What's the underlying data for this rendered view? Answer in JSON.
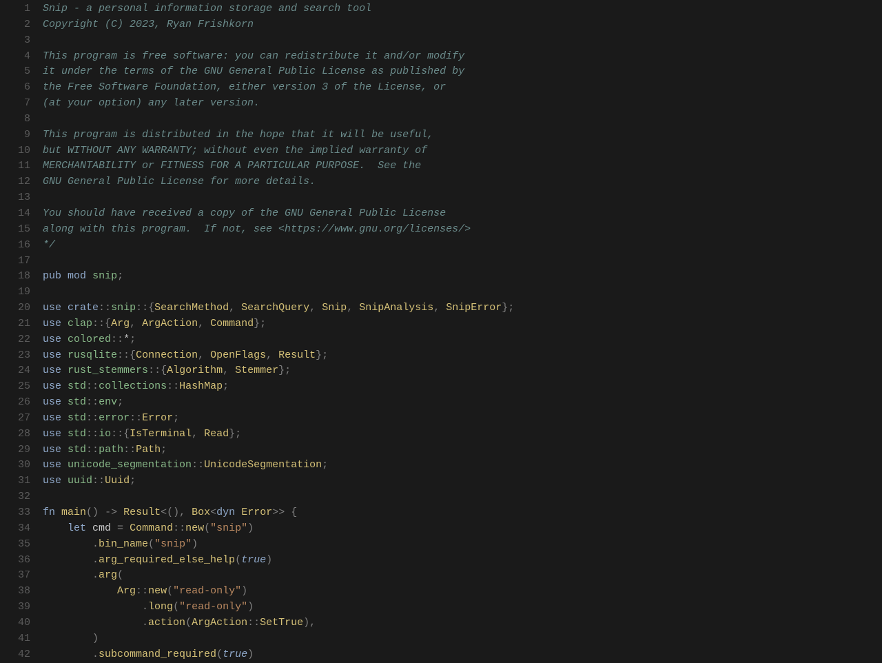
{
  "lines": [
    {
      "n": "1",
      "segs": [
        {
          "c": "comment",
          "t": "Snip - a personal information storage and search tool"
        }
      ]
    },
    {
      "n": "2",
      "segs": [
        {
          "c": "comment",
          "t": "Copyright (C) 2023, Ryan Frishkorn"
        }
      ]
    },
    {
      "n": "3",
      "segs": []
    },
    {
      "n": "4",
      "segs": [
        {
          "c": "comment",
          "t": "This program is free software: you can redistribute it and/or modify"
        }
      ]
    },
    {
      "n": "5",
      "segs": [
        {
          "c": "comment",
          "t": "it under the terms of the GNU General Public License as published by"
        }
      ]
    },
    {
      "n": "6",
      "segs": [
        {
          "c": "comment",
          "t": "the Free Software Foundation, either version 3 of the License, or"
        }
      ]
    },
    {
      "n": "7",
      "segs": [
        {
          "c": "comment",
          "t": "(at your option) any later version."
        }
      ]
    },
    {
      "n": "8",
      "segs": []
    },
    {
      "n": "9",
      "segs": [
        {
          "c": "comment",
          "t": "This program is distributed in the hope that it will be useful,"
        }
      ]
    },
    {
      "n": "10",
      "segs": [
        {
          "c": "comment",
          "t": "but WITHOUT ANY WARRANTY; without even the implied warranty of"
        }
      ]
    },
    {
      "n": "11",
      "segs": [
        {
          "c": "comment",
          "t": "MERCHANTABILITY or FITNESS FOR A PARTICULAR PURPOSE.  See the"
        }
      ]
    },
    {
      "n": "12",
      "segs": [
        {
          "c": "comment",
          "t": "GNU General Public License for more details."
        }
      ]
    },
    {
      "n": "13",
      "segs": []
    },
    {
      "n": "14",
      "segs": [
        {
          "c": "comment",
          "t": "You should have received a copy of the GNU General Public License"
        }
      ]
    },
    {
      "n": "15",
      "segs": [
        {
          "c": "comment",
          "t": "along with this program.  If not, see <https://www.gnu.org/licenses/>"
        }
      ]
    },
    {
      "n": "16",
      "segs": [
        {
          "c": "comment",
          "t": "*/"
        }
      ]
    },
    {
      "n": "17",
      "segs": []
    },
    {
      "n": "18",
      "segs": [
        {
          "c": "keyword",
          "t": "pub"
        },
        {
          "c": "ident",
          "t": " "
        },
        {
          "c": "keyword",
          "t": "mod"
        },
        {
          "c": "ident",
          "t": " "
        },
        {
          "c": "module",
          "t": "snip"
        },
        {
          "c": "punct",
          "t": ";"
        }
      ]
    },
    {
      "n": "19",
      "segs": []
    },
    {
      "n": "20",
      "segs": [
        {
          "c": "keyword",
          "t": "use"
        },
        {
          "c": "ident",
          "t": " "
        },
        {
          "c": "keyword",
          "t": "crate"
        },
        {
          "c": "punct",
          "t": "::"
        },
        {
          "c": "module",
          "t": "snip"
        },
        {
          "c": "punct",
          "t": "::{"
        },
        {
          "c": "type",
          "t": "SearchMethod"
        },
        {
          "c": "punct",
          "t": ", "
        },
        {
          "c": "type",
          "t": "SearchQuery"
        },
        {
          "c": "punct",
          "t": ", "
        },
        {
          "c": "type",
          "t": "Snip"
        },
        {
          "c": "punct",
          "t": ", "
        },
        {
          "c": "type",
          "t": "SnipAnalysis"
        },
        {
          "c": "punct",
          "t": ", "
        },
        {
          "c": "type",
          "t": "SnipError"
        },
        {
          "c": "punct",
          "t": "};"
        }
      ]
    },
    {
      "n": "21",
      "segs": [
        {
          "c": "keyword",
          "t": "use"
        },
        {
          "c": "ident",
          "t": " "
        },
        {
          "c": "module",
          "t": "clap"
        },
        {
          "c": "punct",
          "t": "::{"
        },
        {
          "c": "type",
          "t": "Arg"
        },
        {
          "c": "punct",
          "t": ", "
        },
        {
          "c": "type",
          "t": "ArgAction"
        },
        {
          "c": "punct",
          "t": ", "
        },
        {
          "c": "type",
          "t": "Command"
        },
        {
          "c": "punct",
          "t": "};"
        }
      ]
    },
    {
      "n": "22",
      "segs": [
        {
          "c": "keyword",
          "t": "use"
        },
        {
          "c": "ident",
          "t": " "
        },
        {
          "c": "module",
          "t": "colored"
        },
        {
          "c": "punct",
          "t": "::"
        },
        {
          "c": "star",
          "t": "*"
        },
        {
          "c": "punct",
          "t": ";"
        }
      ]
    },
    {
      "n": "23",
      "segs": [
        {
          "c": "keyword",
          "t": "use"
        },
        {
          "c": "ident",
          "t": " "
        },
        {
          "c": "module",
          "t": "rusqlite"
        },
        {
          "c": "punct",
          "t": "::{"
        },
        {
          "c": "type",
          "t": "Connection"
        },
        {
          "c": "punct",
          "t": ", "
        },
        {
          "c": "type",
          "t": "OpenFlags"
        },
        {
          "c": "punct",
          "t": ", "
        },
        {
          "c": "type",
          "t": "Result"
        },
        {
          "c": "punct",
          "t": "};"
        }
      ]
    },
    {
      "n": "24",
      "segs": [
        {
          "c": "keyword",
          "t": "use"
        },
        {
          "c": "ident",
          "t": " "
        },
        {
          "c": "module",
          "t": "rust_stemmers"
        },
        {
          "c": "punct",
          "t": "::{"
        },
        {
          "c": "type",
          "t": "Algorithm"
        },
        {
          "c": "punct",
          "t": ", "
        },
        {
          "c": "type",
          "t": "Stemmer"
        },
        {
          "c": "punct",
          "t": "};"
        }
      ]
    },
    {
      "n": "25",
      "segs": [
        {
          "c": "keyword",
          "t": "use"
        },
        {
          "c": "ident",
          "t": " "
        },
        {
          "c": "module",
          "t": "std"
        },
        {
          "c": "punct",
          "t": "::"
        },
        {
          "c": "module",
          "t": "collections"
        },
        {
          "c": "punct",
          "t": "::"
        },
        {
          "c": "type",
          "t": "HashMap"
        },
        {
          "c": "punct",
          "t": ";"
        }
      ]
    },
    {
      "n": "26",
      "segs": [
        {
          "c": "keyword",
          "t": "use"
        },
        {
          "c": "ident",
          "t": " "
        },
        {
          "c": "module",
          "t": "std"
        },
        {
          "c": "punct",
          "t": "::"
        },
        {
          "c": "module",
          "t": "env"
        },
        {
          "c": "punct",
          "t": ";"
        }
      ]
    },
    {
      "n": "27",
      "segs": [
        {
          "c": "keyword",
          "t": "use"
        },
        {
          "c": "ident",
          "t": " "
        },
        {
          "c": "module",
          "t": "std"
        },
        {
          "c": "punct",
          "t": "::"
        },
        {
          "c": "module",
          "t": "error"
        },
        {
          "c": "punct",
          "t": "::"
        },
        {
          "c": "type",
          "t": "Error"
        },
        {
          "c": "punct",
          "t": ";"
        }
      ]
    },
    {
      "n": "28",
      "segs": [
        {
          "c": "keyword",
          "t": "use"
        },
        {
          "c": "ident",
          "t": " "
        },
        {
          "c": "module",
          "t": "std"
        },
        {
          "c": "punct",
          "t": "::"
        },
        {
          "c": "module",
          "t": "io"
        },
        {
          "c": "punct",
          "t": "::{"
        },
        {
          "c": "type",
          "t": "IsTerminal"
        },
        {
          "c": "punct",
          "t": ", "
        },
        {
          "c": "type",
          "t": "Read"
        },
        {
          "c": "punct",
          "t": "};"
        }
      ]
    },
    {
      "n": "29",
      "segs": [
        {
          "c": "keyword",
          "t": "use"
        },
        {
          "c": "ident",
          "t": " "
        },
        {
          "c": "module",
          "t": "std"
        },
        {
          "c": "punct",
          "t": "::"
        },
        {
          "c": "module",
          "t": "path"
        },
        {
          "c": "punct",
          "t": "::"
        },
        {
          "c": "type",
          "t": "Path"
        },
        {
          "c": "punct",
          "t": ";"
        }
      ]
    },
    {
      "n": "30",
      "segs": [
        {
          "c": "keyword",
          "t": "use"
        },
        {
          "c": "ident",
          "t": " "
        },
        {
          "c": "module",
          "t": "unicode_segmentation"
        },
        {
          "c": "punct",
          "t": "::"
        },
        {
          "c": "type",
          "t": "UnicodeSegmentation"
        },
        {
          "c": "punct",
          "t": ";"
        }
      ]
    },
    {
      "n": "31",
      "segs": [
        {
          "c": "keyword",
          "t": "use"
        },
        {
          "c": "ident",
          "t": " "
        },
        {
          "c": "module",
          "t": "uuid"
        },
        {
          "c": "punct",
          "t": "::"
        },
        {
          "c": "type",
          "t": "Uuid"
        },
        {
          "c": "punct",
          "t": ";"
        }
      ]
    },
    {
      "n": "32",
      "segs": []
    },
    {
      "n": "33",
      "segs": [
        {
          "c": "keyword",
          "t": "fn"
        },
        {
          "c": "ident",
          "t": " "
        },
        {
          "c": "func",
          "t": "main"
        },
        {
          "c": "punct",
          "t": "() "
        },
        {
          "c": "op",
          "t": "->"
        },
        {
          "c": "ident",
          "t": " "
        },
        {
          "c": "type",
          "t": "Result"
        },
        {
          "c": "punct",
          "t": "<(), "
        },
        {
          "c": "type",
          "t": "Box"
        },
        {
          "c": "punct",
          "t": "<"
        },
        {
          "c": "keyword",
          "t": "dyn"
        },
        {
          "c": "ident",
          "t": " "
        },
        {
          "c": "type",
          "t": "Error"
        },
        {
          "c": "punct",
          "t": ">> {"
        }
      ]
    },
    {
      "n": "34",
      "segs": [
        {
          "c": "ident",
          "t": "    "
        },
        {
          "c": "keyword",
          "t": "let"
        },
        {
          "c": "ident",
          "t": " cmd "
        },
        {
          "c": "op",
          "t": "="
        },
        {
          "c": "ident",
          "t": " "
        },
        {
          "c": "type",
          "t": "Command"
        },
        {
          "c": "punct",
          "t": "::"
        },
        {
          "c": "func",
          "t": "new"
        },
        {
          "c": "punct",
          "t": "("
        },
        {
          "c": "string",
          "t": "\"snip\""
        },
        {
          "c": "punct",
          "t": ")"
        }
      ]
    },
    {
      "n": "35",
      "segs": [
        {
          "c": "ident",
          "t": "        "
        },
        {
          "c": "punct",
          "t": "."
        },
        {
          "c": "func",
          "t": "bin_name"
        },
        {
          "c": "punct",
          "t": "("
        },
        {
          "c": "string",
          "t": "\"snip\""
        },
        {
          "c": "punct",
          "t": ")"
        }
      ]
    },
    {
      "n": "36",
      "segs": [
        {
          "c": "ident",
          "t": "        "
        },
        {
          "c": "punct",
          "t": "."
        },
        {
          "c": "func",
          "t": "arg_required_else_help"
        },
        {
          "c": "punct",
          "t": "("
        },
        {
          "c": "bool",
          "t": "true"
        },
        {
          "c": "punct",
          "t": ")"
        }
      ]
    },
    {
      "n": "37",
      "segs": [
        {
          "c": "ident",
          "t": "        "
        },
        {
          "c": "punct",
          "t": "."
        },
        {
          "c": "func",
          "t": "arg"
        },
        {
          "c": "punct",
          "t": "("
        }
      ]
    },
    {
      "n": "38",
      "segs": [
        {
          "c": "ident",
          "t": "            "
        },
        {
          "c": "type",
          "t": "Arg"
        },
        {
          "c": "punct",
          "t": "::"
        },
        {
          "c": "func",
          "t": "new"
        },
        {
          "c": "punct",
          "t": "("
        },
        {
          "c": "string",
          "t": "\"read-only\""
        },
        {
          "c": "punct",
          "t": ")"
        }
      ]
    },
    {
      "n": "39",
      "segs": [
        {
          "c": "ident",
          "t": "                "
        },
        {
          "c": "punct",
          "t": "."
        },
        {
          "c": "func",
          "t": "long"
        },
        {
          "c": "punct",
          "t": "("
        },
        {
          "c": "string",
          "t": "\"read-only\""
        },
        {
          "c": "punct",
          "t": ")"
        }
      ]
    },
    {
      "n": "40",
      "segs": [
        {
          "c": "ident",
          "t": "                "
        },
        {
          "c": "punct",
          "t": "."
        },
        {
          "c": "func",
          "t": "action"
        },
        {
          "c": "punct",
          "t": "("
        },
        {
          "c": "type",
          "t": "ArgAction"
        },
        {
          "c": "punct",
          "t": "::"
        },
        {
          "c": "type",
          "t": "SetTrue"
        },
        {
          "c": "punct",
          "t": "),"
        }
      ]
    },
    {
      "n": "41",
      "segs": [
        {
          "c": "ident",
          "t": "        "
        },
        {
          "c": "punct",
          "t": ")"
        }
      ]
    },
    {
      "n": "42",
      "segs": [
        {
          "c": "ident",
          "t": "        "
        },
        {
          "c": "punct",
          "t": "."
        },
        {
          "c": "func",
          "t": "subcommand_required"
        },
        {
          "c": "punct",
          "t": "("
        },
        {
          "c": "bool",
          "t": "true"
        },
        {
          "c": "punct",
          "t": ")"
        }
      ]
    }
  ]
}
